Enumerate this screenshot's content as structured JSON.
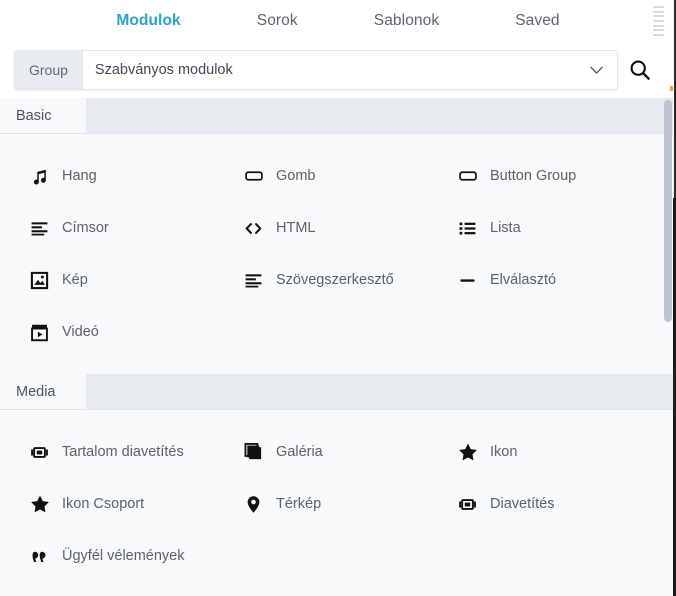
{
  "topbar": {
    "tabs": [
      {
        "label": "Modulok",
        "active": true
      },
      {
        "label": "Sorok",
        "active": false
      },
      {
        "label": "Sablonok",
        "active": false
      },
      {
        "label": "Saved",
        "active": false
      }
    ],
    "grip_icon": "drag-grip-icon",
    "active_color": "#2ba3c7",
    "inactive_color": "#5b6670"
  },
  "search": {
    "group_label": "Group",
    "selected_value": "Szabványos modulok",
    "placeholder": "Szabványos modulok",
    "chevron_icon": "chevron-down-icon",
    "search_icon": "search-icon"
  },
  "sections": [
    {
      "title": "Basic",
      "modules": [
        {
          "label": "Hang",
          "icon": "music-note-icon"
        },
        {
          "label": "Gomb",
          "icon": "button-rect-icon"
        },
        {
          "label": "Button Group",
          "icon": "button-rect-icon"
        },
        {
          "label": "Címsor",
          "icon": "heading-lines-icon"
        },
        {
          "label": "HTML",
          "icon": "code-brackets-icon"
        },
        {
          "label": "Lista",
          "icon": "bullet-list-icon"
        },
        {
          "label": "Kép",
          "icon": "image-icon"
        },
        {
          "label": "Szövegszerkesztő",
          "icon": "heading-lines-icon"
        },
        {
          "label": "Elválasztó",
          "icon": "horizontal-rule-icon"
        },
        {
          "label": "Videó",
          "icon": "video-clapper-icon"
        }
      ]
    },
    {
      "title": "Media",
      "modules": [
        {
          "label": "Tartalom diavetítés",
          "icon": "slideshow-icon"
        },
        {
          "label": "Galéria",
          "icon": "gallery-stack-icon"
        },
        {
          "label": "Ikon",
          "icon": "star-icon"
        },
        {
          "label": "Ikon Csoport",
          "icon": "star-icon"
        },
        {
          "label": "Térkép",
          "icon": "map-pin-icon"
        },
        {
          "label": "Diavetítés",
          "icon": "slideshow-icon"
        },
        {
          "label": "Ügyfél vélemények",
          "icon": "quote-marks-icon"
        }
      ]
    }
  ],
  "scrollbar": {
    "visible": true
  }
}
